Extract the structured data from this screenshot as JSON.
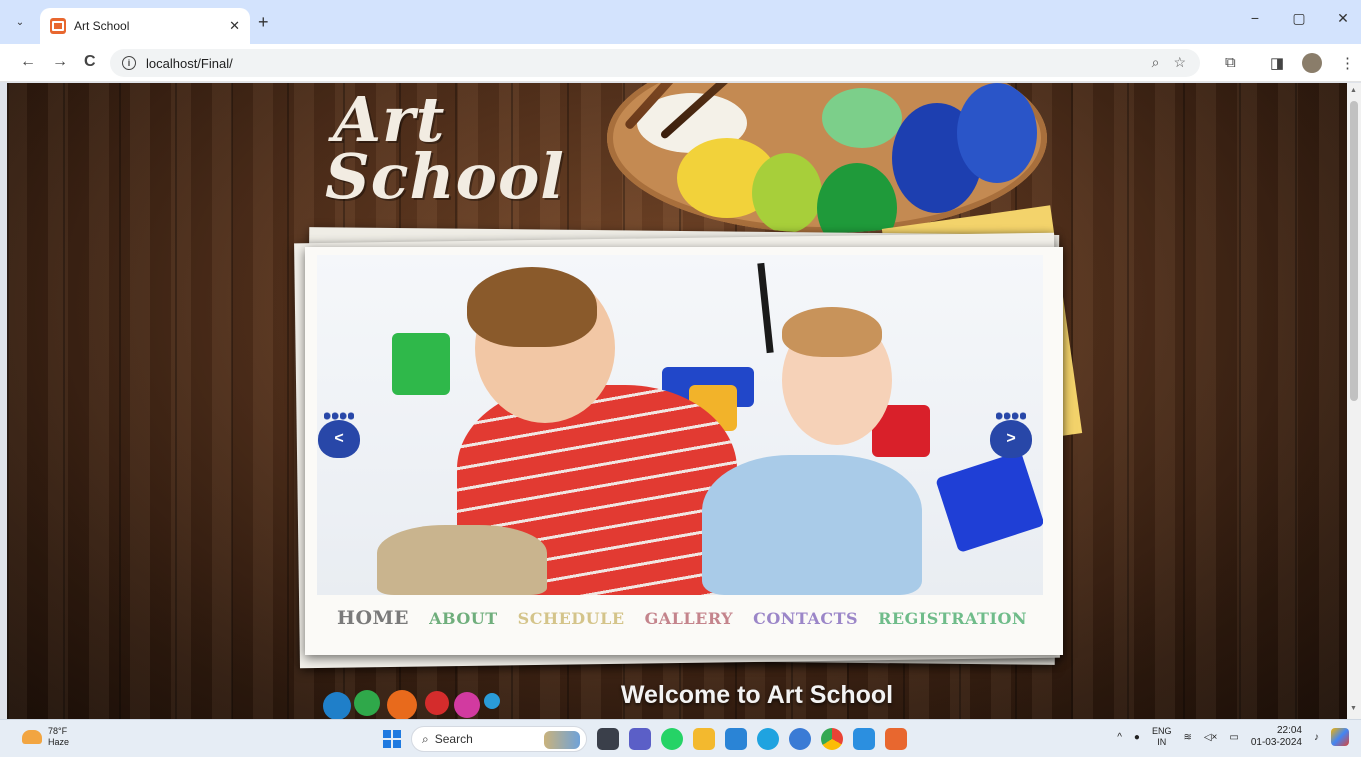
{
  "browser": {
    "tab": {
      "title": "Art School",
      "close_icon": "close-icon",
      "favicon": "art-school-favicon"
    },
    "new_tab": "+",
    "window_controls": {
      "minimize": "−",
      "restore": "▢",
      "close": "✕"
    },
    "toolbar": {
      "back": "←",
      "forward": "→",
      "reload": "C",
      "url": "localhost/Final/",
      "zoom_icon": "⌕",
      "bookmark_icon": "☆",
      "extensions_icon": "⧉",
      "sidepanel_icon": "◨",
      "menu_icon": "⋮"
    }
  },
  "page": {
    "logo": {
      "line1": "Art",
      "line2": "School"
    },
    "slider": {
      "prev": "<",
      "next": ">"
    },
    "menu": [
      {
        "label": "HOME",
        "color": "#7a7a7a"
      },
      {
        "label": "ABOUT",
        "color": "#6fae7c"
      },
      {
        "label": "SCHEDULE",
        "color": "#d4c48a"
      },
      {
        "label": "GALLERY",
        "color": "#c4848c"
      },
      {
        "label": "CONTACTS",
        "color": "#9b86c8"
      },
      {
        "label": "REGISTRATION",
        "color": "#6fbc8a"
      }
    ],
    "welcome": "Welcome to Art School"
  },
  "taskbar": {
    "weather": {
      "temp": "78°F",
      "condition": "Haze"
    },
    "search_placeholder": "Search",
    "tray": {
      "lang1": "ENG",
      "lang2": "IN",
      "time": "22:04",
      "date": "01-03-2024"
    }
  }
}
